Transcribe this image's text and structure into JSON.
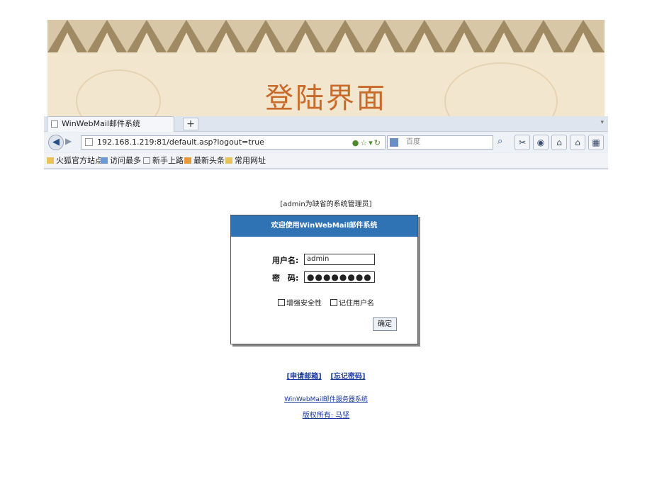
{
  "slide": {
    "title": "登陆界面"
  },
  "browser": {
    "tab_title": "WinWebMail邮件系统",
    "new_tab": "+",
    "url": "192.168.1.219:81/default.asp?logout=true",
    "search_placeholder": "百度",
    "bookmarks": [
      "火狐官方站点",
      "访问最多",
      "新手上路",
      "最新头条",
      "常用网址"
    ]
  },
  "login": {
    "admin_note": "[admin为缺省的系统管理员]",
    "header": "欢迎使用WinWebMail邮件系统",
    "username_label": "用户名:",
    "username_value": "admin",
    "password_label": "密　码:",
    "password_value": "●●●●●●●●",
    "enhance_security": "增强安全性",
    "remember_user": "记住用户名",
    "submit": "确定"
  },
  "links": {
    "apply": "[申请邮箱]",
    "forgot": "[忘记密码]"
  },
  "footer": {
    "product": "WinWebMail邮件服务器系统",
    "copyright": "版权所有: 马坚"
  },
  "colors": {
    "title": "#c86a2a",
    "login_header": "#2f73b5",
    "link": "#1a3a9a"
  }
}
